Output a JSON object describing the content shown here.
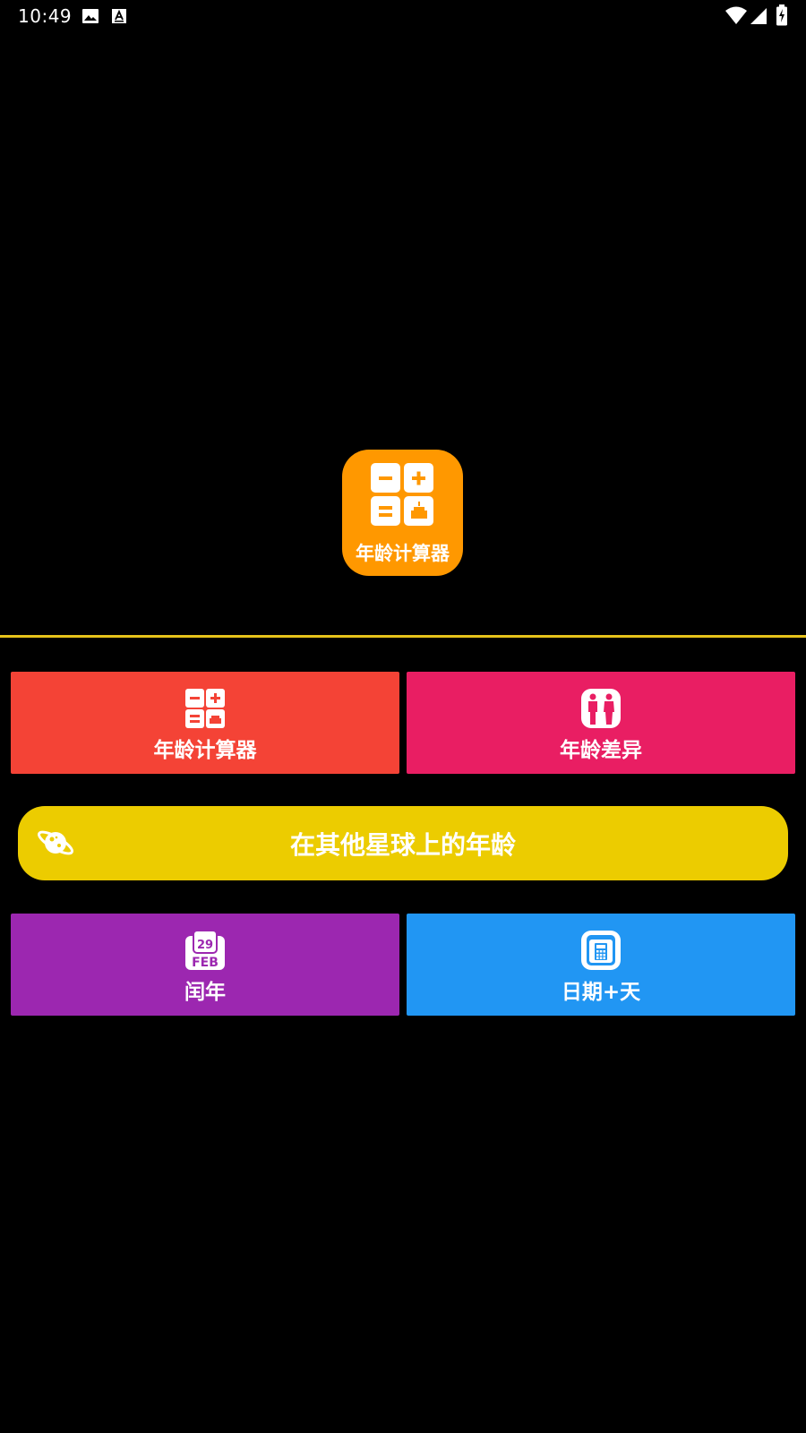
{
  "status_bar": {
    "time": "10:49",
    "icons": [
      "image-icon",
      "a-notification-icon",
      "wifi-icon",
      "signal-icon",
      "battery-charging-icon"
    ]
  },
  "logo": {
    "label": "年龄计算器",
    "color": "#ff9800"
  },
  "divider_color": "#e6c21a",
  "menu": {
    "age_calculator": {
      "label": "年龄计算器",
      "icon": "calculator-cake-icon",
      "color": "#f44336"
    },
    "age_difference": {
      "label": "年龄差异",
      "icon": "two-people-icon",
      "color": "#e91e63"
    },
    "planets": {
      "label": "在其他星球上的年龄",
      "icon": "planet-icon",
      "color": "#eccc00"
    },
    "leap_year": {
      "label": "闰年",
      "icon": "calendar-feb29-icon",
      "icon_text_day": "29",
      "icon_text_month": "FEB",
      "color": "#9c27b0"
    },
    "date_plus_days": {
      "label": "日期+天",
      "icon": "calendar-calculator-icon",
      "color": "#2196f3"
    }
  }
}
